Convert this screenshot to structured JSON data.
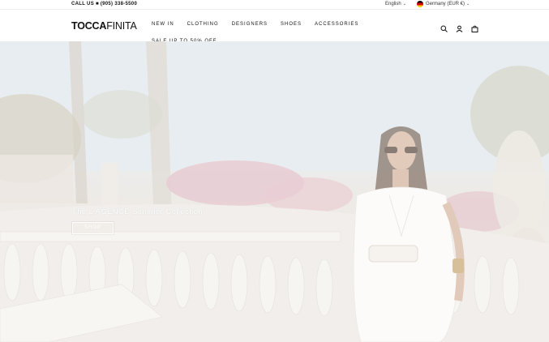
{
  "topbar": {
    "call_label": "CALL US ■ (905) 338-5500",
    "language": "English",
    "country": "Germany (EUR €)"
  },
  "header": {
    "logo_bold": "TOCCA",
    "logo_light": "FINITA",
    "nav": [
      "NEW IN",
      "CLOTHING",
      "DESIGNERS",
      "SHOES",
      "ACCESSORIES",
      "SALE UP TO 50% OFF"
    ],
    "icons": [
      "search-icon",
      "account-icon",
      "cart-icon"
    ]
  },
  "hero": {
    "headline": "The L'AGENCE Summer Collection",
    "button_label": "SHOP"
  }
}
